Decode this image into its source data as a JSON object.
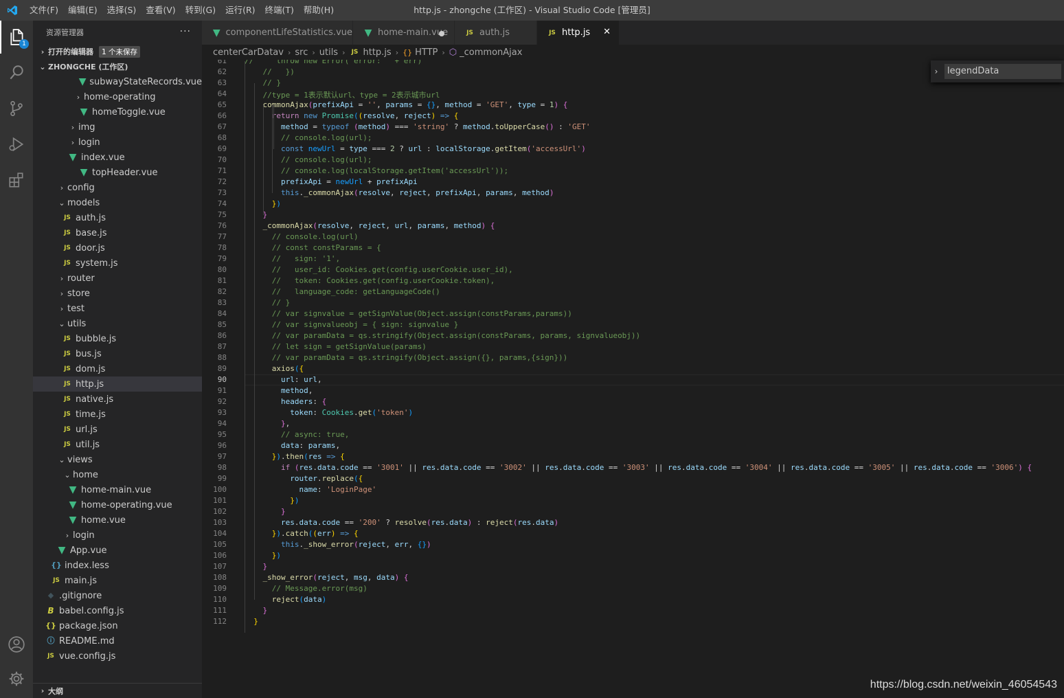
{
  "titlebar": {
    "menus": [
      "文件(F)",
      "编辑(E)",
      "选择(S)",
      "查看(V)",
      "转到(G)",
      "运行(R)",
      "终端(T)",
      "帮助(H)"
    ],
    "title": "http.js - zhongche (工作区) - Visual Studio Code [管理员]"
  },
  "activity": {
    "badge": "1"
  },
  "sidebar": {
    "header": "资源管理器",
    "more": "···",
    "open_editors": "打开的编辑器",
    "unsaved": "1 个未保存",
    "workspace": "ZHONGCHE (工作区)",
    "outline": "大纲",
    "tree": [
      {
        "label": "subwayStateRecords.vue",
        "type": "vue",
        "indent": 66
      },
      {
        "label": "home-operating",
        "type": "folder",
        "indent": 58
      },
      {
        "label": "homeToggle.vue",
        "type": "vue",
        "indent": 66
      },
      {
        "label": "img",
        "type": "folder",
        "indent": 50
      },
      {
        "label": "login",
        "type": "folder",
        "indent": 50
      },
      {
        "label": "index.vue",
        "type": "vue",
        "indent": 50
      },
      {
        "label": "topHeader.vue",
        "type": "vue",
        "indent": 66
      },
      {
        "label": "config",
        "type": "folder",
        "indent": 34
      },
      {
        "label": "models",
        "type": "folder-open",
        "indent": 34
      },
      {
        "label": "auth.js",
        "type": "js",
        "indent": 42
      },
      {
        "label": "base.js",
        "type": "js",
        "indent": 42
      },
      {
        "label": "door.js",
        "type": "js",
        "indent": 42
      },
      {
        "label": "system.js",
        "type": "js",
        "indent": 42
      },
      {
        "label": "router",
        "type": "folder",
        "indent": 34
      },
      {
        "label": "store",
        "type": "folder",
        "indent": 34
      },
      {
        "label": "test",
        "type": "folder",
        "indent": 34
      },
      {
        "label": "utils",
        "type": "folder-open",
        "indent": 34
      },
      {
        "label": "bubble.js",
        "type": "js",
        "indent": 42
      },
      {
        "label": "bus.js",
        "type": "js",
        "indent": 42
      },
      {
        "label": "dom.js",
        "type": "js",
        "indent": 42
      },
      {
        "label": "http.js",
        "type": "js",
        "indent": 42,
        "selected": true
      },
      {
        "label": "native.js",
        "type": "js",
        "indent": 42
      },
      {
        "label": "time.js",
        "type": "js",
        "indent": 42
      },
      {
        "label": "url.js",
        "type": "js",
        "indent": 42
      },
      {
        "label": "util.js",
        "type": "js",
        "indent": 42
      },
      {
        "label": "views",
        "type": "folder-open",
        "indent": 34
      },
      {
        "label": "home",
        "type": "folder-open",
        "indent": 42
      },
      {
        "label": "home-main.vue",
        "type": "vue",
        "indent": 50
      },
      {
        "label": "home-operating.vue",
        "type": "vue",
        "indent": 50
      },
      {
        "label": "home.vue",
        "type": "vue",
        "indent": 50
      },
      {
        "label": "login",
        "type": "folder",
        "indent": 42
      },
      {
        "label": "App.vue",
        "type": "vue",
        "indent": 34
      },
      {
        "label": "index.less",
        "type": "less",
        "indent": 26
      },
      {
        "label": "main.js",
        "type": "js",
        "indent": 26
      },
      {
        "label": ".gitignore",
        "type": "git",
        "indent": 18
      },
      {
        "label": "babel.config.js",
        "type": "babel",
        "indent": 18
      },
      {
        "label": "package.json",
        "type": "json",
        "indent": 18
      },
      {
        "label": "README.md",
        "type": "info",
        "indent": 18
      },
      {
        "label": "vue.config.js",
        "type": "js",
        "indent": 18
      }
    ]
  },
  "tabs": [
    {
      "label": "componentLifeStatistics.vue",
      "type": "vue",
      "width": 220
    },
    {
      "label": "home-main.vue",
      "type": "vue",
      "width": 148,
      "dirty": true
    },
    {
      "label": "auth.js",
      "type": "js",
      "width": 120
    },
    {
      "label": "http.js",
      "type": "js",
      "width": 120,
      "active": true
    }
  ],
  "icons": {
    "js": "JS",
    "vue": "▼",
    "less": "{}",
    "json": "{}",
    "git": "◆",
    "babel": "B",
    "info": "ⓘ",
    "close": "✕",
    "folder": "›",
    "folder_open": "⌄"
  },
  "breadcrumb": [
    "centerCarDatav",
    "src",
    "utils",
    "http.js",
    "HTTP",
    "_commonAjax"
  ],
  "find": {
    "value": "legendData"
  },
  "editor": {
    "current_line": 90,
    "lines": [
      {
        "n": 61,
        "h": "<span class=\"c\">//     throw new Error('error: ' + err)</span>"
      },
      {
        "n": 62,
        "h": "    <span class=\"c\">//   })</span>"
      },
      {
        "n": 63,
        "h": "    <span class=\"c\">// }</span>"
      },
      {
        "n": 64,
        "h": "    <span class=\"c\">//type = 1表示默认url、type = 2表示城市url</span>"
      },
      {
        "n": 65,
        "h": "    <span class=\"f\">commonAjax</span><span class=\"b2\">(</span><span class=\"v\">prefixApi</span> = <span class=\"s\">''</span>, <span class=\"v\">params</span> = <span class=\"b3\">{}</span>, <span class=\"v\">method</span> = <span class=\"s\">'GET'</span>, <span class=\"v\">type</span> = <span class=\"n\">1</span><span class=\"b2\">)</span> <span class=\"b2\">{</span>"
      },
      {
        "n": 66,
        "h": "      <span class=\"kc\">return</span> <span class=\"k\">new</span> <span class=\"t\">Promise</span><span class=\"b3\">(</span><span class=\"b1\">(</span><span class=\"v\">resolve</span>, <span class=\"v\">reject</span><span class=\"b1\">)</span> <span class=\"k\">=&gt;</span> <span class=\"b1\">{</span>"
      },
      {
        "n": 67,
        "h": "        <span class=\"v\">method</span> = <span class=\"k\">typeof</span> <span class=\"b2\">(</span><span class=\"v\">method</span><span class=\"b2\">)</span> === <span class=\"s\">'string'</span> ? <span class=\"v\">method</span>.<span class=\"f\">toUpperCase</span><span class=\"b2\">()</span> : <span class=\"s\">'GET'</span>"
      },
      {
        "n": 68,
        "h": "        <span class=\"c\">// console.log(url);</span>"
      },
      {
        "n": 69,
        "h": "        <span class=\"k\">const</span> <span class=\"b3\">newUrl</span> = <span class=\"v\">type</span> === <span class=\"n\">2</span> ? <span class=\"v\">url</span> : <span class=\"v\">localStorage</span>.<span class=\"f\">getItem</span><span class=\"b2\">(</span><span class=\"s\">'accessUrl'</span><span class=\"b2\">)</span>"
      },
      {
        "n": 70,
        "h": "        <span class=\"c\">// console.log(url);</span>"
      },
      {
        "n": 71,
        "h": "        <span class=\"c\">// console.log(localStorage.getItem('accessUrl'));</span>"
      },
      {
        "n": 72,
        "h": "        <span class=\"v\">prefixApi</span> = <span class=\"b3\">newUrl</span> + <span class=\"v\">prefixApi</span>"
      },
      {
        "n": 73,
        "h": "        <span class=\"k\">this</span>.<span class=\"f\">_commonAjax</span><span class=\"b2\">(</span><span class=\"v\">resolve</span>, <span class=\"v\">reject</span>, <span class=\"v\">prefixApi</span>, <span class=\"v\">params</span>, <span class=\"v\">method</span><span class=\"b2\">)</span>"
      },
      {
        "n": 74,
        "h": "      <span class=\"b1\">}</span><span class=\"b3\">)</span>"
      },
      {
        "n": 75,
        "h": "    <span class=\"b2\">}</span>"
      },
      {
        "n": 76,
        "h": "    <span class=\"f\">_commonAjax</span><span class=\"b2\">(</span><span class=\"v\">resolve</span>, <span class=\"v\">reject</span>, <span class=\"v\">url</span>, <span class=\"v\">params</span>, <span class=\"v\">method</span><span class=\"b2\">)</span> <span class=\"b2\">{</span>"
      },
      {
        "n": 77,
        "h": "      <span class=\"c\">// console.log(url)</span>"
      },
      {
        "n": 78,
        "h": "      <span class=\"c\">// const constParams = {</span>"
      },
      {
        "n": 79,
        "h": "      <span class=\"c\">//   sign: '1',</span>"
      },
      {
        "n": 80,
        "h": "      <span class=\"c\">//   user_id: Cookies.get(config.userCookie.user_id),</span>"
      },
      {
        "n": 81,
        "h": "      <span class=\"c\">//   token: Cookies.get(config.userCookie.token),</span>"
      },
      {
        "n": 82,
        "h": "      <span class=\"c\">//   language_code: getLanguageCode()</span>"
      },
      {
        "n": 83,
        "h": "      <span class=\"c\">// }</span>"
      },
      {
        "n": 84,
        "h": "      <span class=\"c\">// var signvalue = getSignValue(Object.assign(constParams,params))</span>"
      },
      {
        "n": 85,
        "h": "      <span class=\"c\">// var signvalueobj = { sign: signvalue }</span>"
      },
      {
        "n": 86,
        "h": "      <span class=\"c\">// var paramData = qs.stringify(Object.assign(constParams, params, signvalueobj))</span>"
      },
      {
        "n": 87,
        "h": "      <span class=\"c\">// let sign = getSignValue(params)</span>"
      },
      {
        "n": 88,
        "h": "      <span class=\"c\">// var paramData = qs.stringify(Object.assign({}, params,{sign}))</span>"
      },
      {
        "n": 89,
        "h": "      <span class=\"f\">axios</span><span class=\"b3\">(</span><span class=\"b1\">{</span>"
      },
      {
        "n": 90,
        "h": "        <span class=\"v\">url</span>: <span class=\"v\">url</span>,"
      },
      {
        "n": 91,
        "h": "        <span class=\"v\">method</span>,"
      },
      {
        "n": 92,
        "h": "        <span class=\"v\">headers</span>: <span class=\"b2\">{</span>"
      },
      {
        "n": 93,
        "h": "          <span class=\"v\">token</span>: <span class=\"t\">Cookies</span>.<span class=\"f\">get</span><span class=\"b3\">(</span><span class=\"s\">'token'</span><span class=\"b3\">)</span>"
      },
      {
        "n": 94,
        "h": "        <span class=\"b2\">}</span>,"
      },
      {
        "n": 95,
        "h": "        <span class=\"c\">// async: true,</span>"
      },
      {
        "n": 96,
        "h": "        <span class=\"v\">data</span>: <span class=\"v\">params</span>,"
      },
      {
        "n": 97,
        "h": "      <span class=\"b1\">}</span><span class=\"b3\">)</span>.<span class=\"f\">then</span><span class=\"b3\">(</span><span class=\"v\">res</span> <span class=\"k\">=&gt;</span> <span class=\"b1\">{</span>"
      },
      {
        "n": 98,
        "h": "        <span class=\"kc\">if</span> <span class=\"b2\">(</span><span class=\"v\">res</span>.<span class=\"v\">data</span>.<span class=\"v\">code</span> == <span class=\"s\">'3001'</span> || <span class=\"v\">res</span>.<span class=\"v\">data</span>.<span class=\"v\">code</span> == <span class=\"s\">'3002'</span> || <span class=\"v\">res</span>.<span class=\"v\">data</span>.<span class=\"v\">code</span> == <span class=\"s\">'3003'</span> || <span class=\"v\">res</span>.<span class=\"v\">data</span>.<span class=\"v\">code</span> == <span class=\"s\">'3004'</span> || <span class=\"v\">res</span>.<span class=\"v\">data</span>.<span class=\"v\">code</span> == <span class=\"s\">'3005'</span> || <span class=\"v\">res</span>.<span class=\"v\">data</span>.<span class=\"v\">code</span> == <span class=\"s\">'3006'</span><span class=\"b2\">)</span> <span class=\"b2\">{</span>"
      },
      {
        "n": 99,
        "h": "          <span class=\"v\">router</span>.<span class=\"f\">replace</span><span class=\"b3\">(</span><span class=\"b1\">{</span>"
      },
      {
        "n": 100,
        "h": "            <span class=\"v\">name</span>: <span class=\"s\">'LoginPage'</span>"
      },
      {
        "n": 101,
        "h": "          <span class=\"b1\">}</span><span class=\"b3\">)</span>"
      },
      {
        "n": 102,
        "h": "        <span class=\"b2\">}</span>"
      },
      {
        "n": 103,
        "h": "        <span class=\"v\">res</span>.<span class=\"v\">data</span>.<span class=\"v\">code</span> == <span class=\"s\">'200'</span> ? <span class=\"f\">resolve</span><span class=\"b2\">(</span><span class=\"v\">res</span>.<span class=\"v\">data</span><span class=\"b2\">)</span> : <span class=\"f\">reject</span><span class=\"b2\">(</span><span class=\"v\">res</span>.<span class=\"v\">data</span><span class=\"b2\">)</span>"
      },
      {
        "n": 104,
        "h": "      <span class=\"b1\">}</span><span class=\"b3\">)</span>.<span class=\"f\">catch</span><span class=\"b3\">(</span><span class=\"b1\">(</span><span class=\"v\">err</span><span class=\"b1\">)</span> <span class=\"k\">=&gt;</span> <span class=\"b1\">{</span>"
      },
      {
        "n": 105,
        "h": "        <span class=\"k\">this</span>.<span class=\"f\">_show_error</span><span class=\"b2\">(</span><span class=\"v\">reject</span>, <span class=\"v\">err</span>, <span class=\"b3\">{}</span><span class=\"b2\">)</span>"
      },
      {
        "n": 106,
        "h": "      <span class=\"b1\">}</span><span class=\"b3\">)</span>"
      },
      {
        "n": 107,
        "h": "    <span class=\"b2\">}</span>"
      },
      {
        "n": 108,
        "h": "    <span class=\"f\">_show_error</span><span class=\"b2\">(</span><span class=\"v\">reject</span>, <span class=\"v\">msg</span>, <span class=\"v\">data</span><span class=\"b2\">)</span> <span class=\"b2\">{</span>"
      },
      {
        "n": 109,
        "h": "      <span class=\"c\">// Message.error(msg)</span>"
      },
      {
        "n": 110,
        "h": "      <span class=\"f\">reject</span><span class=\"b3\">(</span><span class=\"v\">data</span><span class=\"b3\">)</span>"
      },
      {
        "n": 111,
        "h": "    <span class=\"b2\">}</span>"
      },
      {
        "n": 112,
        "h": "  <span class=\"b1\">}</span>"
      }
    ]
  },
  "watermark": "https://blog.csdn.net/weixin_46054543"
}
